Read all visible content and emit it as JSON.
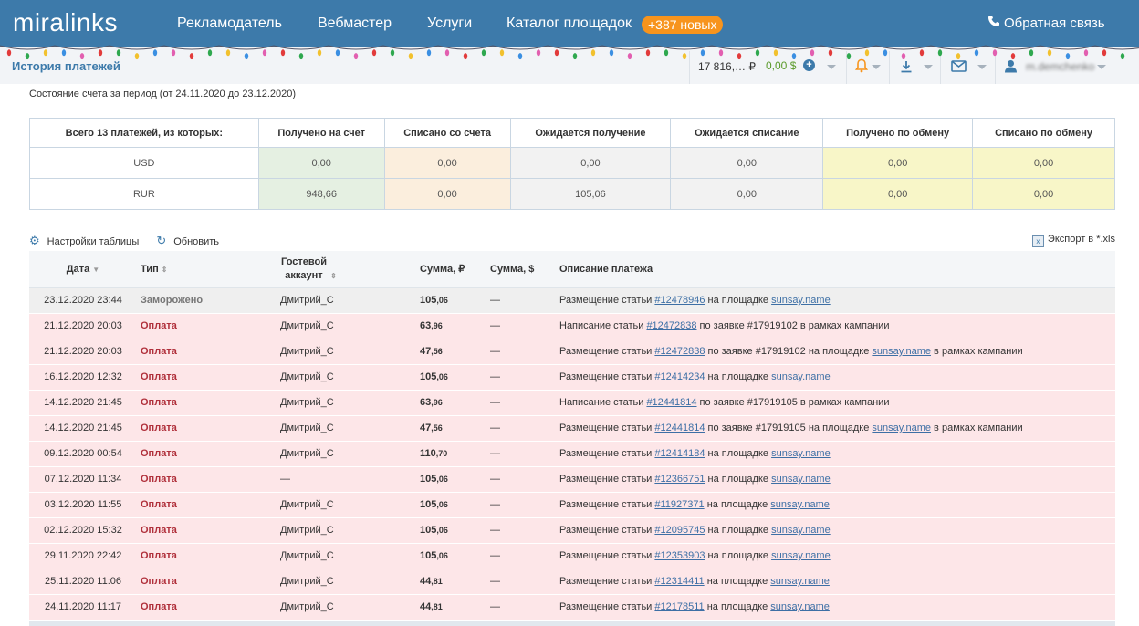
{
  "header": {
    "logo": "miralinks",
    "nav": [
      "Рекламодатель",
      "Вебмастер",
      "Услуги",
      "Каталог площадок"
    ],
    "badge": "+387 новых",
    "feedback": "Обратная связь"
  },
  "subheader": {
    "title": "История платежей",
    "balance_rub": "17 816,… ₽",
    "balance_usd": "0,00 $",
    "username": "m.demchenko"
  },
  "period_text": "Состояние счета за период (от 24.11.2020 до 23.12.2020)",
  "summary": {
    "columns": [
      "Всего 13 платежей, из которых:",
      "Получено на счет",
      "Списано со счета",
      "Ожидается получение",
      "Ожидается списание",
      "Получено по обмену",
      "Списано по обмену"
    ],
    "rows": [
      {
        "currency": "USD",
        "values": [
          "0,00",
          "0,00",
          "0,00",
          "0,00",
          "0,00",
          "0,00"
        ]
      },
      {
        "currency": "RUR",
        "values": [
          "948,66",
          "0,00",
          "105,06",
          "0,00",
          "0,00",
          "0,00"
        ]
      }
    ]
  },
  "toolbar": {
    "settings": "Настройки таблицы",
    "refresh": "Обновить",
    "export": "Экспорт в *.xls"
  },
  "payments": {
    "columns": {
      "date": "Дата",
      "type": "Тип",
      "guest": "Гостевой аккаунт",
      "sum_rub": "Сумма, ₽",
      "sum_usd": "Сумма, $",
      "desc": "Описание платежа"
    },
    "rows": [
      {
        "date": "23.12.2020 23:44",
        "type": "Заморожено",
        "kind": "frozen",
        "guest": "Дмитрий_С",
        "sum_int": "105",
        "sum_frac": ",06",
        "usd": "—",
        "pre": "Размещение статьи ",
        "link1": "#12478946",
        "mid": " на площадке ",
        "link2": "sunsay.name",
        "post": ""
      },
      {
        "date": "21.12.2020 20:03",
        "type": "Оплата",
        "kind": "pay",
        "guest": "Дмитрий_С",
        "sum_int": "63",
        "sum_frac": ",96",
        "usd": "—",
        "pre": "Написание статьи ",
        "link1": "#12472838",
        "mid": " по заявке #17919102 в рамках кампании",
        "link2": "",
        "post": ""
      },
      {
        "date": "21.12.2020 20:03",
        "type": "Оплата",
        "kind": "pay",
        "guest": "Дмитрий_С",
        "sum_int": "47",
        "sum_frac": ",56",
        "usd": "—",
        "pre": "Размещение статьи ",
        "link1": "#12472838",
        "mid": " по заявке #17919102 на площадке ",
        "link2": "sunsay.name",
        "post": " в рамках кампании"
      },
      {
        "date": "16.12.2020 12:32",
        "type": "Оплата",
        "kind": "pay",
        "guest": "Дмитрий_С",
        "sum_int": "105",
        "sum_frac": ",06",
        "usd": "—",
        "pre": "Размещение статьи ",
        "link1": "#12414234",
        "mid": " на площадке ",
        "link2": "sunsay.name",
        "post": ""
      },
      {
        "date": "14.12.2020 21:45",
        "type": "Оплата",
        "kind": "pay",
        "guest": "Дмитрий_С",
        "sum_int": "63",
        "sum_frac": ",96",
        "usd": "—",
        "pre": "Написание статьи ",
        "link1": "#12441814",
        "mid": " по заявке #17919105 в рамках кампании",
        "link2": "",
        "post": ""
      },
      {
        "date": "14.12.2020 21:45",
        "type": "Оплата",
        "kind": "pay",
        "guest": "Дмитрий_С",
        "sum_int": "47",
        "sum_frac": ",56",
        "usd": "—",
        "pre": "Размещение статьи ",
        "link1": "#12441814",
        "mid": " по заявке #17919105 на площадке ",
        "link2": "sunsay.name",
        "post": " в рамках кампании"
      },
      {
        "date": "09.12.2020 00:54",
        "type": "Оплата",
        "kind": "pay",
        "guest": "Дмитрий_С",
        "sum_int": "110",
        "sum_frac": ",70",
        "usd": "—",
        "pre": "Размещение статьи ",
        "link1": "#12414184",
        "mid": " на площадке ",
        "link2": "sunsay.name",
        "post": ""
      },
      {
        "date": "07.12.2020 11:34",
        "type": "Оплата",
        "kind": "pay",
        "guest": "—",
        "sum_int": "105",
        "sum_frac": ",06",
        "usd": "—",
        "pre": "Размещение статьи ",
        "link1": "#12366751",
        "mid": " на площадке ",
        "link2": "sunsay.name",
        "post": ""
      },
      {
        "date": "03.12.2020 11:55",
        "type": "Оплата",
        "kind": "pay",
        "guest": "Дмитрий_С",
        "sum_int": "105",
        "sum_frac": ",06",
        "usd": "—",
        "pre": "Размещение статьи ",
        "link1": "#11927371",
        "mid": " на площадке ",
        "link2": "sunsay.name",
        "post": ""
      },
      {
        "date": "02.12.2020 15:32",
        "type": "Оплата",
        "kind": "pay",
        "guest": "Дмитрий_С",
        "sum_int": "105",
        "sum_frac": ",06",
        "usd": "—",
        "pre": "Размещение статьи ",
        "link1": "#12095745",
        "mid": " на площадке ",
        "link2": "sunsay.name",
        "post": ""
      },
      {
        "date": "29.11.2020 22:42",
        "type": "Оплата",
        "kind": "pay",
        "guest": "Дмитрий_С",
        "sum_int": "105",
        "sum_frac": ",06",
        "usd": "—",
        "pre": "Размещение статьи ",
        "link1": "#12353903",
        "mid": " на площадке ",
        "link2": "sunsay.name",
        "post": ""
      },
      {
        "date": "25.11.2020 11:06",
        "type": "Оплата",
        "kind": "pay",
        "guest": "Дмитрий_С",
        "sum_int": "44",
        "sum_frac": ",81",
        "usd": "—",
        "pre": "Размещение статьи ",
        "link1": "#12314411",
        "mid": " на площадке ",
        "link2": "sunsay.name",
        "post": ""
      },
      {
        "date": "24.11.2020 11:17",
        "type": "Оплата",
        "kind": "pay",
        "guest": "Дмитрий_С",
        "sum_int": "44",
        "sum_frac": ",81",
        "usd": "—",
        "pre": "Размещение статьи ",
        "link1": "#12178511",
        "mid": " на площадке ",
        "link2": "sunsay.name",
        "post": ""
      }
    ]
  },
  "colors": {
    "header_bg": "#3d7aaa",
    "badge": "#f7941d",
    "pay_row": "#fde6e8",
    "frozen_row": "#efefef",
    "pay_type": "#b0303b",
    "usd_balance": "#5a9a2a"
  }
}
